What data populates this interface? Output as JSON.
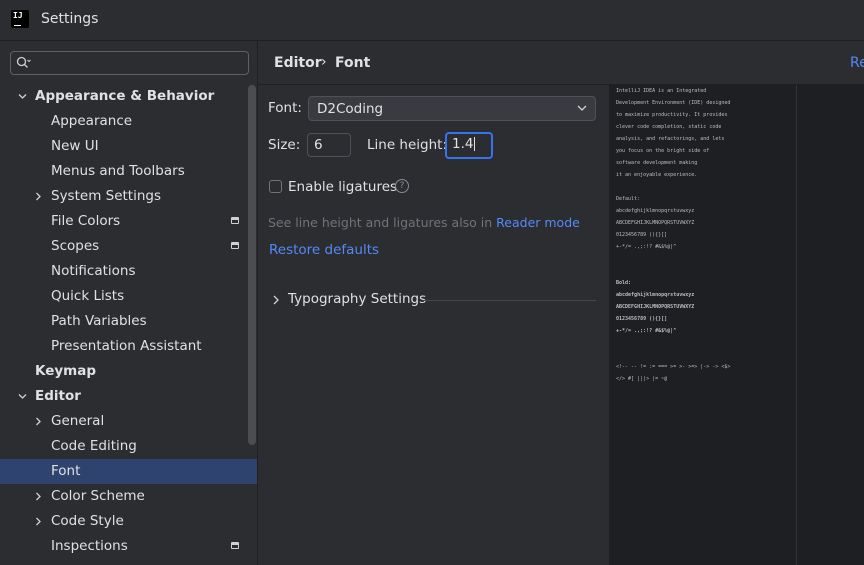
{
  "window": {
    "title": "Settings",
    "app_icon_text": "IJ"
  },
  "search": {
    "placeholder": ""
  },
  "tree": {
    "items": [
      {
        "label": "Appearance & Behavior",
        "expander": "expanded",
        "bold": true,
        "indent": 0,
        "badge": false,
        "selected": false
      },
      {
        "label": "Appearance",
        "expander": "none",
        "bold": false,
        "indent": 1,
        "badge": false,
        "selected": false
      },
      {
        "label": "New UI",
        "expander": "none",
        "bold": false,
        "indent": 1,
        "badge": false,
        "selected": false
      },
      {
        "label": "Menus and Toolbars",
        "expander": "none",
        "bold": false,
        "indent": 1,
        "badge": false,
        "selected": false
      },
      {
        "label": "System Settings",
        "expander": "collapsed",
        "bold": false,
        "indent": 1,
        "badge": false,
        "selected": false
      },
      {
        "label": "File Colors",
        "expander": "none",
        "bold": false,
        "indent": 1,
        "badge": true,
        "selected": false
      },
      {
        "label": "Scopes",
        "expander": "none",
        "bold": false,
        "indent": 1,
        "badge": true,
        "selected": false
      },
      {
        "label": "Notifications",
        "expander": "none",
        "bold": false,
        "indent": 1,
        "badge": false,
        "selected": false
      },
      {
        "label": "Quick Lists",
        "expander": "none",
        "bold": false,
        "indent": 1,
        "badge": false,
        "selected": false
      },
      {
        "label": "Path Variables",
        "expander": "none",
        "bold": false,
        "indent": 1,
        "badge": false,
        "selected": false
      },
      {
        "label": "Presentation Assistant",
        "expander": "none",
        "bold": false,
        "indent": 1,
        "badge": false,
        "selected": false
      },
      {
        "label": "Keymap",
        "expander": "none",
        "bold": true,
        "indent": 0,
        "badge": false,
        "selected": false
      },
      {
        "label": "Editor",
        "expander": "expanded",
        "bold": true,
        "indent": 0,
        "badge": false,
        "selected": false
      },
      {
        "label": "General",
        "expander": "collapsed",
        "bold": false,
        "indent": 1,
        "badge": false,
        "selected": false
      },
      {
        "label": "Code Editing",
        "expander": "none",
        "bold": false,
        "indent": 1,
        "badge": false,
        "selected": false
      },
      {
        "label": "Font",
        "expander": "none",
        "bold": false,
        "indent": 1,
        "badge": false,
        "selected": true
      },
      {
        "label": "Color Scheme",
        "expander": "collapsed",
        "bold": false,
        "indent": 1,
        "badge": false,
        "selected": false
      },
      {
        "label": "Code Style",
        "expander": "collapsed",
        "bold": false,
        "indent": 1,
        "badge": false,
        "selected": false
      },
      {
        "label": "Inspections",
        "expander": "none",
        "bold": false,
        "indent": 1,
        "badge": true,
        "selected": false
      }
    ]
  },
  "breadcrumb": {
    "parent": "Editor",
    "separator": "›",
    "current": "Font",
    "reset_label": "Re"
  },
  "form": {
    "font_label": "Font:",
    "font_value": "D2Coding",
    "size_label": "Size:",
    "size_value": "6",
    "line_height_label": "Line height:",
    "line_height_value": "1.4",
    "ligatures_label": "Enable ligatures",
    "ligatures_checked": false,
    "help_glyph": "?",
    "hint_text": "See line height and ligatures also in ",
    "hint_link": "Reader mode",
    "restore_label": "Restore defaults",
    "typography_label": "Typography Settings"
  },
  "preview": {
    "lines": [
      {
        "text": "IntelliJ IDEA is an Integrated",
        "bold": false
      },
      {
        "text": "Development Environment (IDE) designed",
        "bold": false
      },
      {
        "text": "to maximize productivity. It provides",
        "bold": false
      },
      {
        "text": "clever code completion, static code",
        "bold": false
      },
      {
        "text": "analysis, and refactorings, and lets",
        "bold": false
      },
      {
        "text": "you focus on the bright side of",
        "bold": false
      },
      {
        "text": "software development making",
        "bold": false
      },
      {
        "text": "it an enjoyable experience.",
        "bold": false
      },
      {
        "text": "",
        "bold": false
      },
      {
        "text": "Default:",
        "bold": false
      },
      {
        "text": "abcdefghijklmnopqrstuvwxyz",
        "bold": false
      },
      {
        "text": "ABCDEFGHIJKLMNOPQRSTUVWXYZ",
        "bold": false
      },
      {
        "text": " 0123456789 (){}[]",
        "bold": false
      },
      {
        "text": " +-*/= .,;:!? #&$%@|^",
        "bold": false
      },
      {
        "text": "",
        "bold": false
      },
      {
        "text": "",
        "bold": false
      },
      {
        "text": "Bold:",
        "bold": true
      },
      {
        "text": "abcdefghijklmnopqrstuvwxyz",
        "bold": true
      },
      {
        "text": "ABCDEFGHIJKLMNOPQRSTUVWXYZ",
        "bold": true
      },
      {
        "text": " 0123456789 (){}[]",
        "bold": true
      },
      {
        "text": " +-*/= .,;:!? #&$%@|^",
        "bold": true
      },
      {
        "text": "",
        "bold": false
      },
      {
        "text": "",
        "bold": false
      },
      {
        "text": "<!-- -- != := === >= >- >=> |-> -> <$>",
        "bold": false
      },
      {
        "text": "</> #[ |||> |= ~@",
        "bold": false
      }
    ]
  },
  "colors": {
    "accent": "#3574f0",
    "link": "#548af7",
    "selection": "#2e436e"
  }
}
